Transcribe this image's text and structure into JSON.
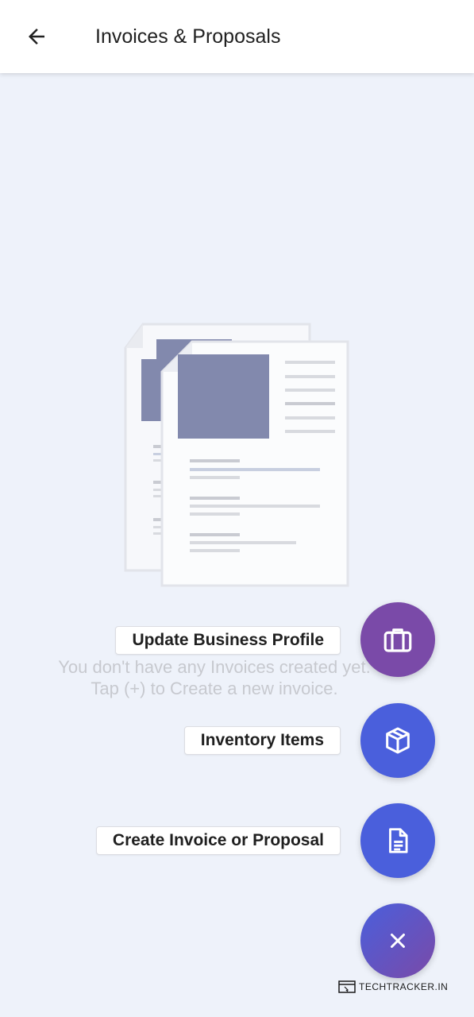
{
  "appbar": {
    "title": "Invoices & Proposals",
    "back_icon": "arrow-left-icon"
  },
  "empty_state": {
    "line1": "You don't have any Invoices created yet.",
    "line2": "Tap (+) to Create a new invoice.",
    "illustration": "documents-icon"
  },
  "fab_menu": {
    "items": [
      {
        "label": "Update Business Profile",
        "icon": "briefcase-icon",
        "color": "#7a4aa8"
      },
      {
        "label": "Inventory Items",
        "icon": "box-icon",
        "color": "#4a5fdc"
      },
      {
        "label": "Create Invoice or Proposal",
        "icon": "document-icon",
        "color": "#4a5fdc"
      }
    ],
    "close_icon": "close-icon"
  },
  "watermark": {
    "text": "TECHTRACKER.IN"
  },
  "colors": {
    "background": "#eef2fa",
    "appbar": "#ffffff",
    "accent_purple": "#7a4aa8",
    "accent_blue": "#4a5fdc",
    "muted_text": "#c7c9cf"
  }
}
